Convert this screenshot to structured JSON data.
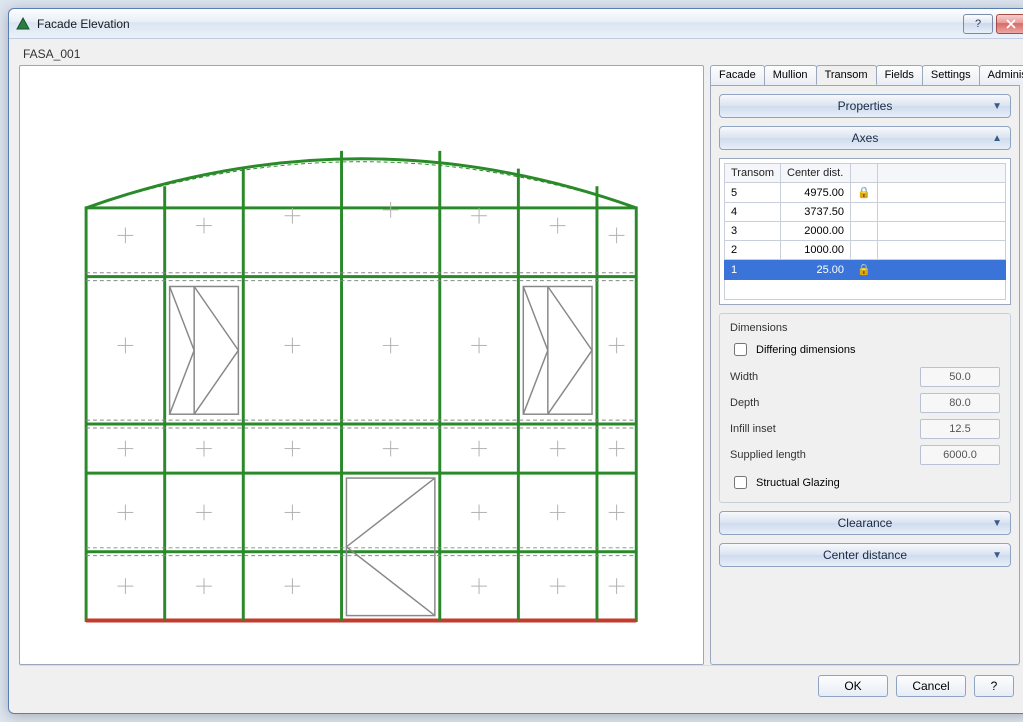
{
  "window": {
    "title": "Facade Elevation"
  },
  "identifier": "FASA_001",
  "tabs": [
    {
      "label": "Facade"
    },
    {
      "label": "Mullion"
    },
    {
      "label": "Transom"
    },
    {
      "label": "Fields"
    },
    {
      "label": "Settings"
    },
    {
      "label": "Administration"
    }
  ],
  "active_tab_index": 2,
  "accordions": {
    "properties": "Properties",
    "axes": "Axes",
    "clearance": "Clearance",
    "center_distance": "Center distance"
  },
  "table": {
    "headers": {
      "transom": "Transom",
      "center_dist": "Center dist."
    },
    "rows": [
      {
        "transom": "5",
        "center_dist": "4975.00",
        "locked": true,
        "selected": false
      },
      {
        "transom": "4",
        "center_dist": "3737.50",
        "locked": false,
        "selected": false
      },
      {
        "transom": "3",
        "center_dist": "2000.00",
        "locked": false,
        "selected": false
      },
      {
        "transom": "2",
        "center_dist": "1000.00",
        "locked": false,
        "selected": false
      },
      {
        "transom": "1",
        "center_dist": "25.00",
        "locked": true,
        "selected": true
      }
    ]
  },
  "dimensions": {
    "legend": "Dimensions",
    "differing_label": "Differing dimensions",
    "differing_checked": false,
    "width_label": "Width",
    "width_value": "50.0",
    "depth_label": "Depth",
    "depth_value": "80.0",
    "infill_label": "Infill inset",
    "infill_value": "12.5",
    "supplied_label": "Supplied length",
    "supplied_value": "6000.0",
    "structural_label": "Structual Glazing",
    "structural_checked": false
  },
  "footer": {
    "ok": "OK",
    "cancel": "Cancel",
    "help": "?"
  }
}
